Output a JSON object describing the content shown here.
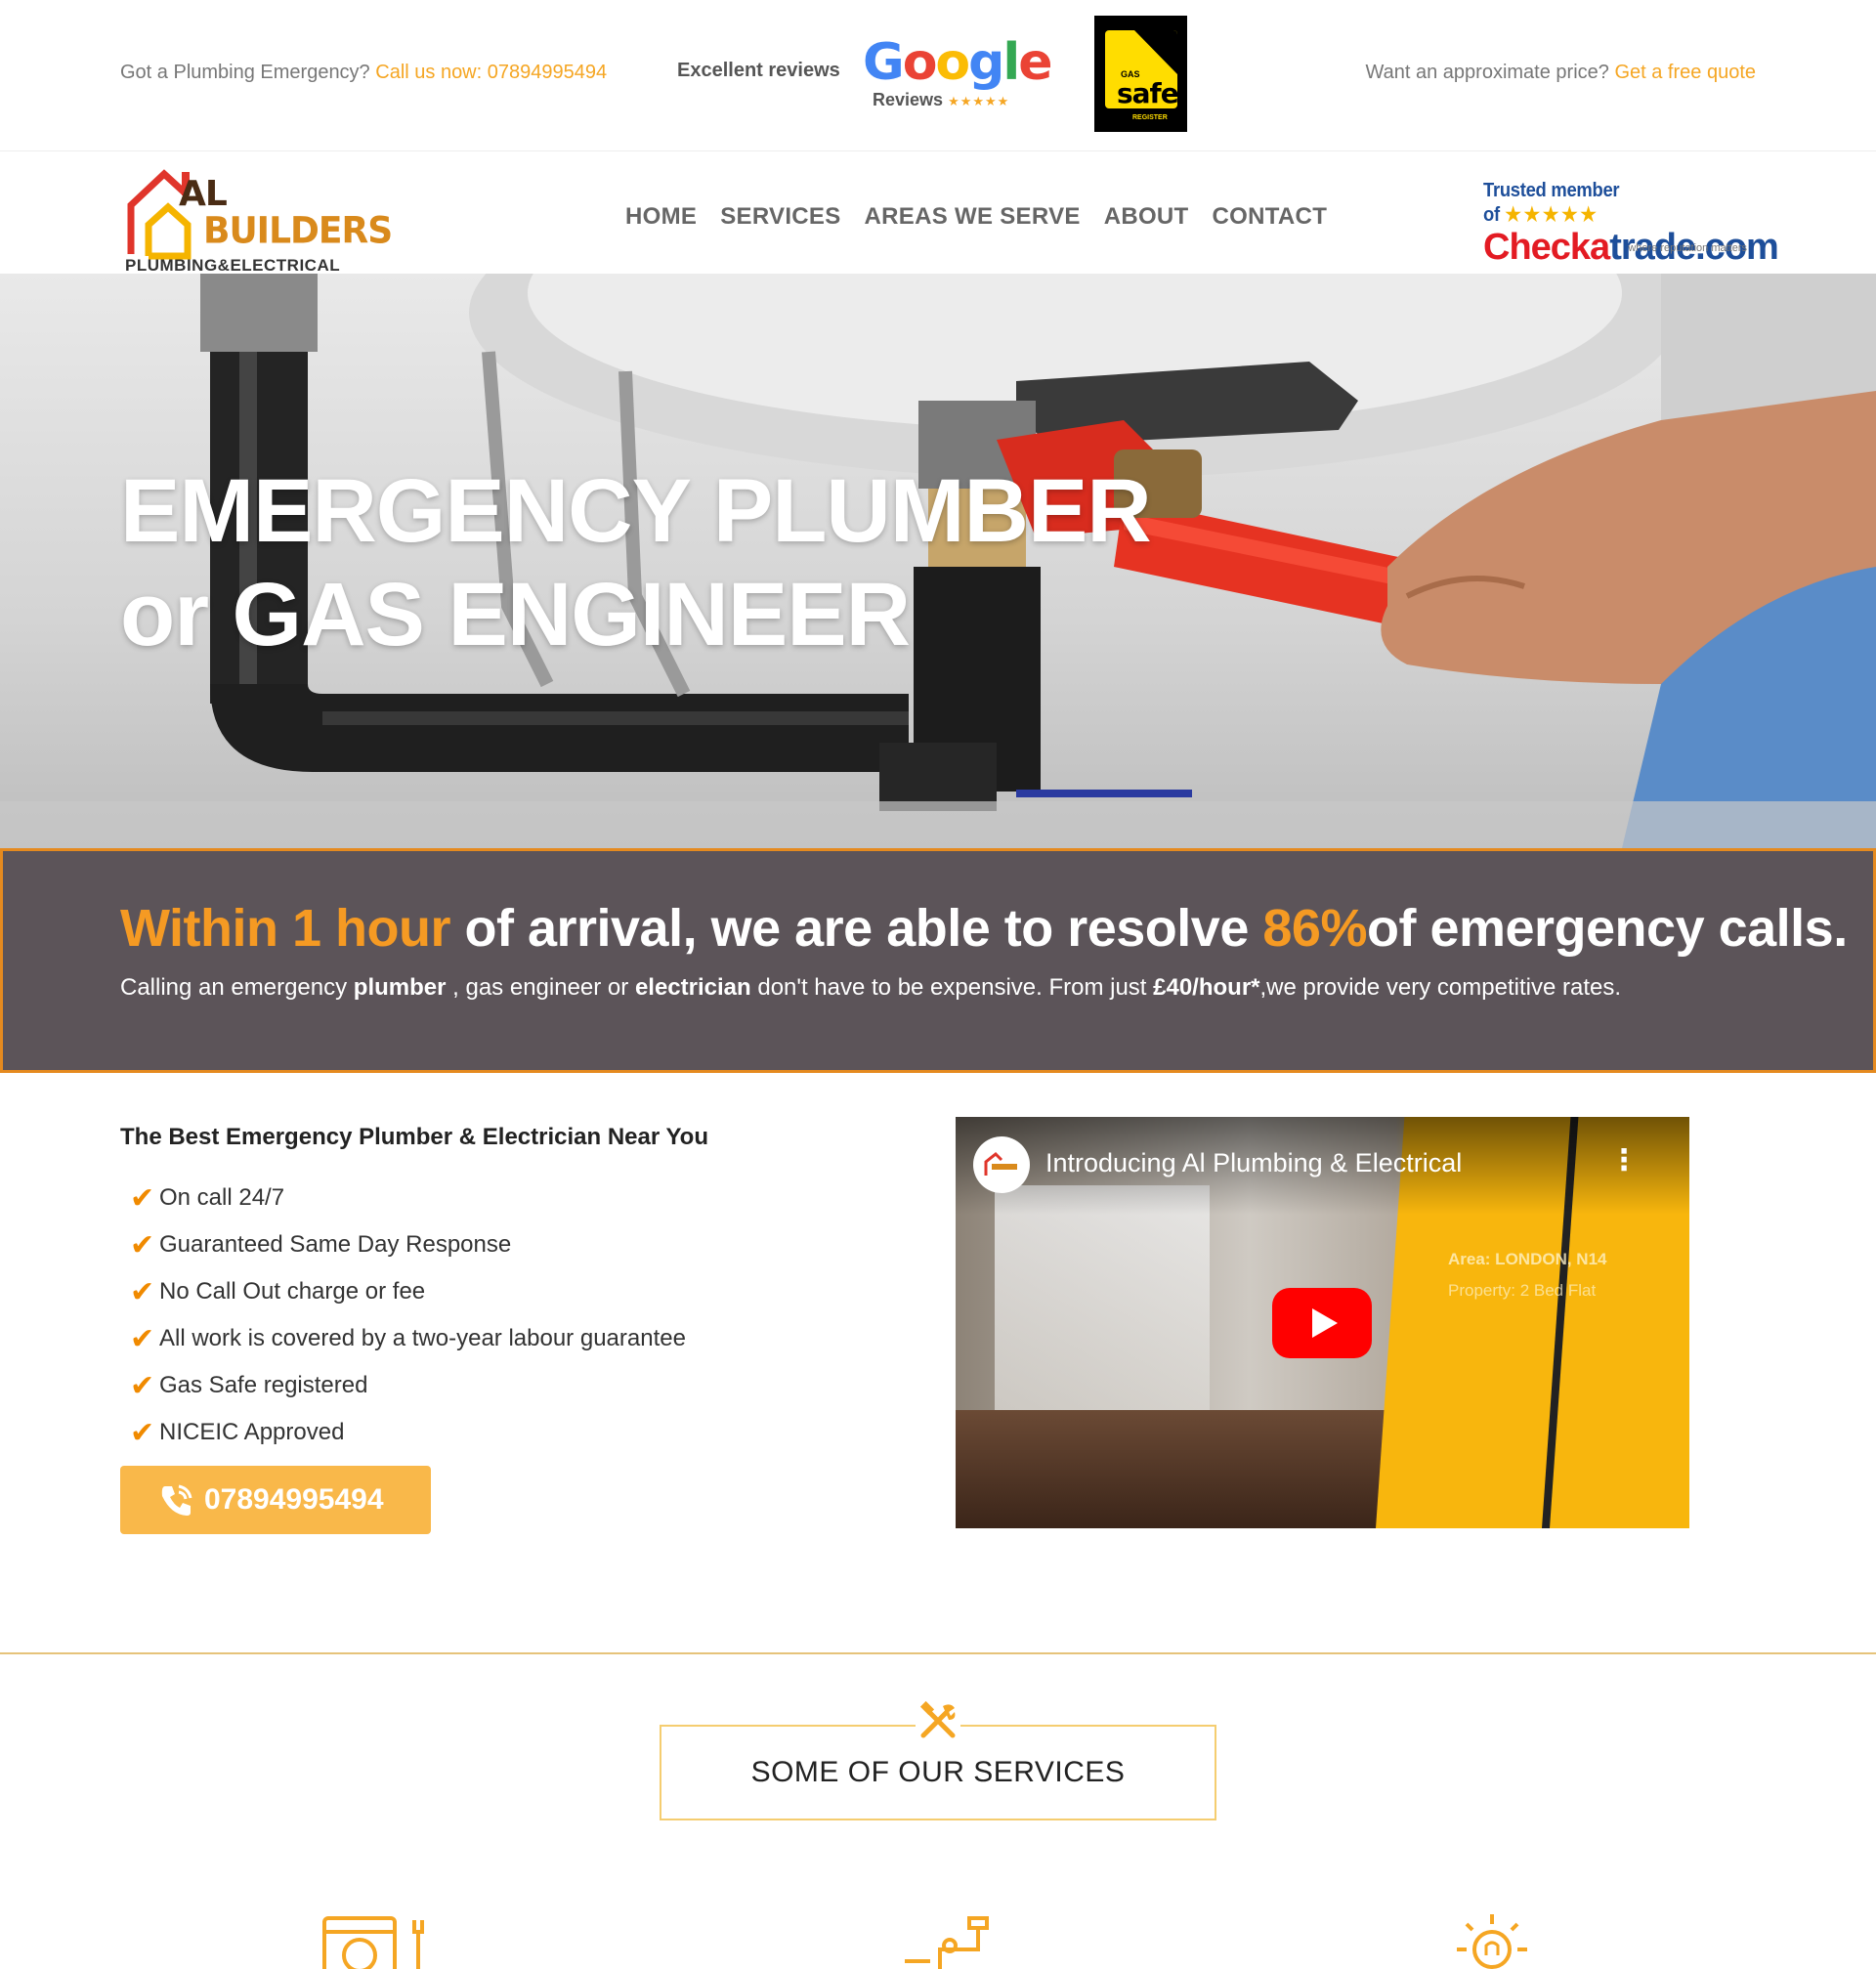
{
  "topbar": {
    "emergency_text": "Got a Plumbing Emergency?",
    "emergency_link": "Call us now: 07894995494",
    "reviews_label": "Excellent reviews",
    "google_word": "Google",
    "google_sub": "Reviews",
    "google_stars": "★★★★★",
    "gassafe_gas": "GAS",
    "gassafe_safe": "safe",
    "gassafe_register": "REGISTER",
    "quote_text": "Want an approximate price?",
    "quote_link": "Get a free quote"
  },
  "logo": {
    "line1": "AL",
    "line2": "BUILDERS",
    "line3": "PLUMBING&ELECTRICAL"
  },
  "nav": {
    "items": [
      "HOME",
      "SERVICES",
      "AREAS WE SERVE",
      "ABOUT",
      "CONTACT"
    ]
  },
  "checkatrade": {
    "trusted": "Trusted member of",
    "stars": "★★★★★",
    "brand_a": "Checka",
    "brand_b": "trade.com",
    "tagline": "where reputation matters"
  },
  "hero": {
    "title_line1": "EMERGENCY PLUMBER",
    "title_line2": "or GAS ENGINEER"
  },
  "banner": {
    "headline_hl1": "Within 1 hour",
    "headline_mid": " of arrival, we are able to resolve ",
    "headline_hl2": "86%",
    "headline_end": "of emergency calls.",
    "sub_1": "Calling an emergency ",
    "sub_b1": "plumber",
    "sub_2": " , gas engineer or ",
    "sub_b2": "electrician",
    "sub_3": " don't have to be expensive. From just ",
    "sub_b3": "£40/hour*",
    "sub_4": ",we provide very competitive rates."
  },
  "features": {
    "heading": "The Best Emergency Plumber & Electrician Near You",
    "items": [
      "On call 24/7",
      "Guaranteed Same Day Response",
      "No Call Out charge or fee",
      "All work is covered by a two-year labour guarantee",
      "Gas Safe registered",
      "NICEIC Approved"
    ],
    "call_label": "07894995494"
  },
  "video": {
    "title": "Introducing Al Plumbing & Electrical",
    "area": "Area: LONDON, N14",
    "property": "Property: 2 Bed Flat"
  },
  "services": {
    "heading": "SOME OF OUR SERVICES"
  },
  "colors": {
    "accent": "#f5a623",
    "banner_bg": "#5c5459",
    "banner_border": "#e58a1f",
    "highlight": "#f59a23",
    "button": "#f9b84a"
  },
  "icons": [
    "phone-icon",
    "check-icon",
    "play-icon",
    "tools-icon",
    "washing-machine-icon",
    "tap-icon",
    "lightbulb-icon"
  ]
}
